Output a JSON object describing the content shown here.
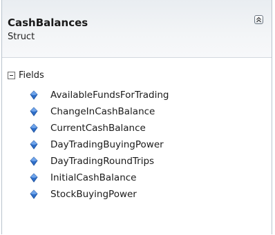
{
  "class_box": {
    "title": "CashBalances",
    "kind": "Struct",
    "collapse_icon": "double-chevron-up-icon"
  },
  "fields_section": {
    "title": "Fields",
    "toggle_icon": "minus-box-icon",
    "item_icon": "field-diamond-icon",
    "items": [
      {
        "label": "AvailableFundsForTrading"
      },
      {
        "label": "ChangeInCashBalance"
      },
      {
        "label": "CurrentCashBalance"
      },
      {
        "label": "DayTradingBuyingPower"
      },
      {
        "label": "DayTradingRoundTrips"
      },
      {
        "label": "InitialCashBalance"
      },
      {
        "label": "StockBuyingPower"
      }
    ]
  },
  "colors": {
    "header_bg": "#eef1f4",
    "border": "#b8c2cc",
    "field_icon": "#2f6fc9"
  }
}
